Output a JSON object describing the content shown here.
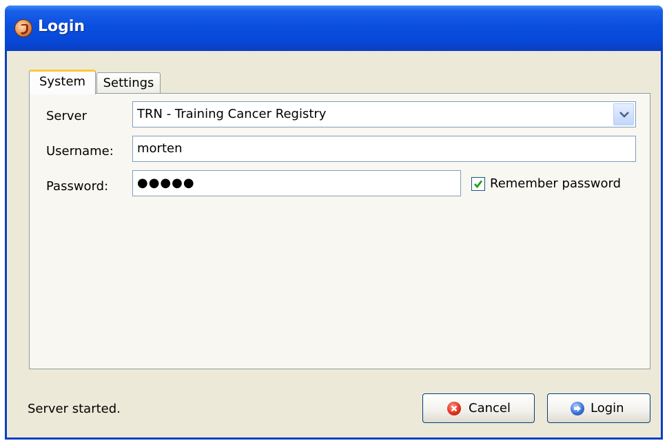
{
  "window": {
    "title": "Login",
    "app_icon": "app-logo-icon"
  },
  "tabs": [
    {
      "label": "System",
      "selected": true
    },
    {
      "label": "Settings",
      "selected": false
    }
  ],
  "form": {
    "server_label": "Server",
    "server_value": "TRN - Training Cancer Registry",
    "username_label": "Username:",
    "username_value": "morten",
    "password_label": "Password:",
    "password_value": "●●●●●",
    "remember_label": "Remember password",
    "remember_checked": true
  },
  "status": {
    "text": "Server started."
  },
  "buttons": {
    "cancel_label": "Cancel",
    "cancel_icon": "cancel-icon",
    "login_label": "Login",
    "login_icon": "login-arrow-icon"
  },
  "colors": {
    "titlebar": "#0a4fe0",
    "dialog_bg": "#ece9d8",
    "tab_highlight": "#ffc83c",
    "check_mark": "#21a121"
  }
}
